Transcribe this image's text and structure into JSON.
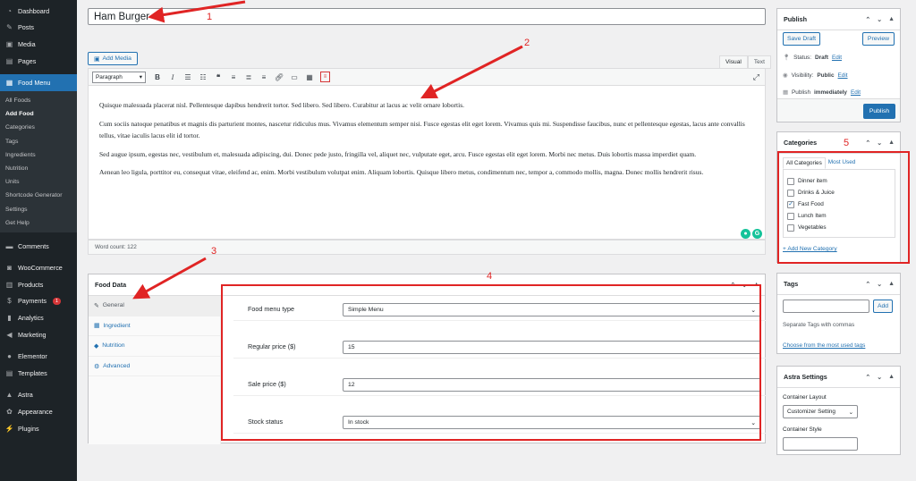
{
  "sidebar": {
    "top": [
      {
        "label": "Dashboard",
        "icon": "dashboard-icon",
        "glyph": "◔"
      },
      {
        "label": "Posts",
        "icon": "pin-icon",
        "glyph": "✎"
      },
      {
        "label": "Media",
        "icon": "media-icon",
        "glyph": "▣"
      },
      {
        "label": "Pages",
        "icon": "pages-icon",
        "glyph": "▤"
      }
    ],
    "active": {
      "label": "Food Menu",
      "icon": "food-menu-icon",
      "glyph": "▦"
    },
    "sub": [
      "All Foods",
      "Add Food",
      "Categories",
      "Tags",
      "Ingredients",
      "Nutrition",
      "Units",
      "Shortcode Generator",
      "Settings",
      "Get Help"
    ],
    "bottom": [
      {
        "label": "Comments",
        "icon": "comments-icon",
        "glyph": "▬"
      },
      {
        "label": "WooCommerce",
        "icon": "woocommerce-icon",
        "glyph": "◙"
      },
      {
        "label": "Products",
        "icon": "products-icon",
        "glyph": "▥"
      },
      {
        "label": "Payments",
        "icon": "payments-icon",
        "glyph": "$",
        "badge": "1"
      },
      {
        "label": "Analytics",
        "icon": "analytics-icon",
        "glyph": "▮"
      },
      {
        "label": "Marketing",
        "icon": "marketing-icon",
        "glyph": "◀"
      },
      {
        "label": "Elementor",
        "icon": "elementor-icon",
        "glyph": "●"
      },
      {
        "label": "Templates",
        "icon": "templates-icon",
        "glyph": "▤"
      },
      {
        "label": "Astra",
        "icon": "astra-icon",
        "glyph": "▲"
      },
      {
        "label": "Appearance",
        "icon": "appearance-icon",
        "glyph": "✿"
      },
      {
        "label": "Plugins",
        "icon": "plugins-icon",
        "glyph": "⚡"
      }
    ]
  },
  "post": {
    "title": "Ham Burger"
  },
  "editor": {
    "add_media": "Add Media",
    "tab_visual": "Visual",
    "tab_text": "Text",
    "format": "Paragraph",
    "paragraphs": [
      "Quisque malesuada placerat nisl. Pellentesque dapibus hendrerit tortor. Sed libero. Sed libero. Curabitur at lacus ac velit ornare lobortis.",
      "Cum sociis natoque penatibus et magnis dis parturient montes, nascetur ridiculus mus. Vivamus elementum semper nisi. Fusce egestas elit eget lorem. Vivamus quis mi. Suspendisse faucibus, nunc et pellentesque egestas, lacus ante convallis tellus, vitae iaculis lacus elit id tortor.",
      "Sed augue ipsum, egestas nec, vestibulum et, malesuada adipiscing, dui. Donec pede justo, fringilla vel, aliquet nec, vulputate eget, arcu. Fusce egestas elit eget lorem. Morbi nec metus. Duis lobortis massa imperdiet quam.",
      "Aenean leo ligula, porttitor eu, consequat vitae, eleifend ac, enim. Morbi vestibulum volutpat enim. Aliquam lobortis. Quisque libero metus, condimentum nec, tempor a, commodo mollis, magna. Donec mollis hendrerit risus."
    ],
    "word_count": "Word count: 122"
  },
  "food_data": {
    "title": "Food Data",
    "tabs": [
      "General",
      "Ingredient",
      "Nutrition",
      "Advanced"
    ],
    "fields": [
      {
        "label": "Food menu type",
        "value": "Simple Menu",
        "type": "select"
      },
      {
        "label": "Regular price ($)",
        "value": "15",
        "type": "input"
      },
      {
        "label": "Sale price ($)",
        "value": "12",
        "type": "input"
      },
      {
        "label": "Stock status",
        "value": "In stock",
        "type": "select"
      }
    ]
  },
  "publish": {
    "title": "Publish",
    "save_draft": "Save Draft",
    "preview": "Preview",
    "status_label": "Status:",
    "status_value": "Draft",
    "visibility_label": "Visibility:",
    "visibility_value": "Public",
    "schedule_label": "Publish",
    "schedule_value": "immediately",
    "edit": "Edit",
    "publish_button": "Publish"
  },
  "categories": {
    "title": "Categories",
    "tab_all": "All Categories",
    "tab_most_used": "Most Used",
    "items": [
      {
        "label": "Dinner item",
        "checked": false
      },
      {
        "label": "Drinks & Juice",
        "checked": false
      },
      {
        "label": "Fast Food",
        "checked": true
      },
      {
        "label": "Lunch Item",
        "checked": false
      },
      {
        "label": "Vegetables",
        "checked": false
      }
    ],
    "add_new": "+ Add New Category"
  },
  "tags": {
    "title": "Tags",
    "add": "Add",
    "hint": "Separate Tags with commas",
    "choose": "Choose from the most used tags"
  },
  "astra": {
    "title": "Astra Settings",
    "container_layout_label": "Container Layout",
    "container_layout_value": "Customizer Setting",
    "container_style_label": "Container Style"
  },
  "annotations": [
    "1",
    "2",
    "3",
    "4",
    "5"
  ],
  "colors": {
    "accent": "#2271b1",
    "sidebar": "#1d2327",
    "annotation": "#e02424"
  }
}
